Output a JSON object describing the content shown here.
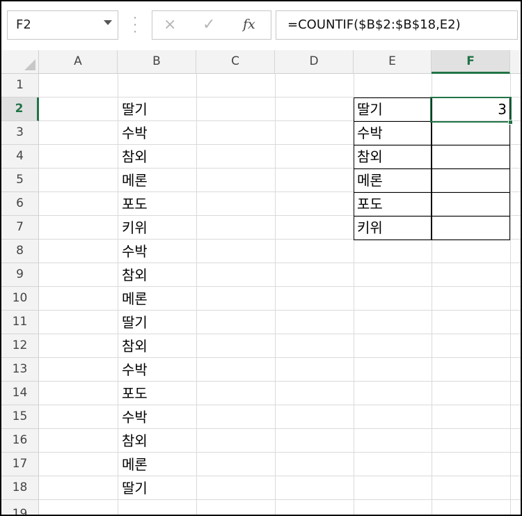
{
  "formula_bar": {
    "name_box": "F2",
    "formula": "=COUNTIF($B$2:$B$18,E2)",
    "cancel_icon": "×",
    "enter_icon": "✓",
    "fx_label": "fx"
  },
  "grid": {
    "columns": [
      "A",
      "B",
      "C",
      "D",
      "E",
      "F"
    ],
    "rows": [
      "1",
      "2",
      "3",
      "4",
      "5",
      "6",
      "7",
      "8",
      "9",
      "10",
      "11",
      "12",
      "13",
      "14",
      "15",
      "16",
      "17",
      "18",
      "19"
    ],
    "selected_column": "F",
    "selected_row": "2",
    "column_b": {
      "r2": "딸기",
      "r3": "수박",
      "r4": "참외",
      "r5": "메론",
      "r6": "포도",
      "r7": "키위",
      "r8": "수박",
      "r9": "참외",
      "r10": "메론",
      "r11": "딸기",
      "r12": "참외",
      "r13": "수박",
      "r14": "포도",
      "r15": "수박",
      "r16": "참외",
      "r17": "메론",
      "r18": "딸기"
    },
    "column_e": {
      "r2": "딸기",
      "r3": "수박",
      "r4": "참외",
      "r5": "메론",
      "r6": "포도",
      "r7": "키위"
    },
    "column_f": {
      "r2": "3"
    }
  }
}
